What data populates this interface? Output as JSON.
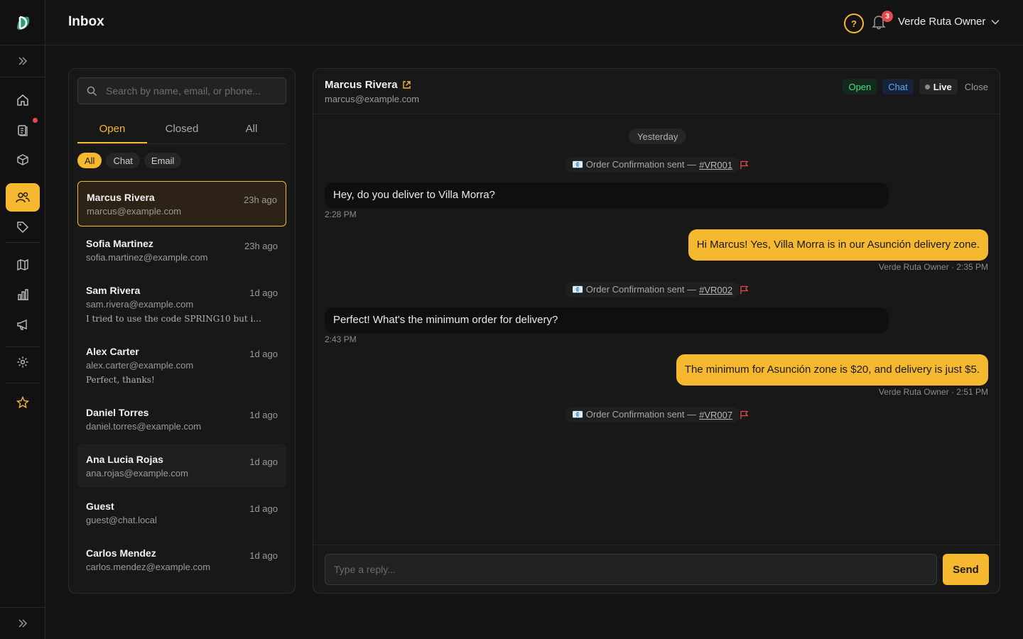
{
  "header": {
    "title": "Inbox",
    "user_name": "Verde Ruta Owner",
    "notification_count": "3"
  },
  "search": {
    "placeholder": "Search by name, email, or phone..."
  },
  "tabs": [
    {
      "label": "Open"
    },
    {
      "label": "Closed"
    },
    {
      "label": "All"
    }
  ],
  "filters": [
    {
      "label": "All"
    },
    {
      "label": "Chat"
    },
    {
      "label": "Email"
    }
  ],
  "conversations": [
    {
      "name": "Marcus Rivera",
      "email": "marcus@example.com",
      "time": "23h ago",
      "preview": ""
    },
    {
      "name": "Sofia Martinez",
      "email": "sofia.martinez@example.com",
      "time": "23h ago",
      "preview": ""
    },
    {
      "name": "Sam Rivera",
      "email": "sam.rivera@example.com",
      "time": "1d ago",
      "preview": "I tried to use the code SPRING10 but i..."
    },
    {
      "name": "Alex Carter",
      "email": "alex.carter@example.com",
      "time": "1d ago",
      "preview": "Perfect, thanks!"
    },
    {
      "name": "Daniel Torres",
      "email": "daniel.torres@example.com",
      "time": "1d ago",
      "preview": ""
    },
    {
      "name": "Ana Lucia Rojas",
      "email": "ana.rojas@example.com",
      "time": "1d ago",
      "preview": ""
    },
    {
      "name": "Guest",
      "email": "guest@chat.local",
      "time": "1d ago",
      "preview": ""
    },
    {
      "name": "Carlos Mendez",
      "email": "carlos.mendez@example.com",
      "time": "1d ago",
      "preview": ""
    }
  ],
  "chat": {
    "name": "Marcus Rivera",
    "email": "marcus@example.com",
    "status_badge": "Open",
    "channel_badge": "Chat",
    "live_badge": "Live",
    "close_label": "Close",
    "date_separator": "Yesterday",
    "events": [
      {
        "text": "📧 Order Confirmation sent —",
        "order": "#VR001"
      },
      {
        "text": "📧 Order Confirmation sent —",
        "order": "#VR002"
      },
      {
        "text": "📧 Order Confirmation sent —",
        "order": "#VR007"
      }
    ],
    "messages": [
      {
        "text": "Hey, do you deliver to Villa Morra?",
        "time": "2:28 PM"
      },
      {
        "text": "Hi Marcus! Yes, Villa Morra is in our Asunción delivery zone.",
        "meta": "Verde Ruta Owner · 2:35 PM"
      },
      {
        "text": "Perfect! What's the minimum order for delivery?",
        "time": "2:43 PM"
      },
      {
        "text": "The minimum for Asunción zone is $20, and delivery is just $5.",
        "meta": "Verde Ruta Owner · 2:51 PM"
      }
    ],
    "reply_placeholder": "Type a reply...",
    "send_label": "Send"
  },
  "colors": {
    "accent": "#f5b82e",
    "open_green": "#4ade80",
    "chat_blue": "#60a5fa",
    "alert_red": "#e5484d"
  }
}
